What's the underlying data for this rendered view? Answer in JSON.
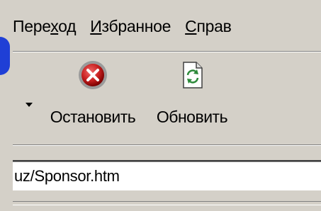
{
  "menubar": {
    "items": [
      {
        "prefix": "Пере",
        "accel": "х",
        "suffix": "од"
      },
      {
        "prefix": "",
        "accel": "И",
        "suffix": "збранное"
      },
      {
        "prefix": "",
        "accel": "С",
        "suffix": "прав"
      }
    ]
  },
  "toolbar": {
    "stop_label": "Остановить",
    "refresh_label": "Обновить",
    "stop_icon": "stop-icon",
    "refresh_icon": "refresh-icon",
    "dropdown_icon": "dropdown-arrow-icon"
  },
  "addressbar": {
    "value": "uz/Sponsor.htm"
  },
  "colors": {
    "chrome": "#d4d0c8",
    "stop_red": "#cc2222",
    "logo_blue": "#1f3fd6"
  }
}
